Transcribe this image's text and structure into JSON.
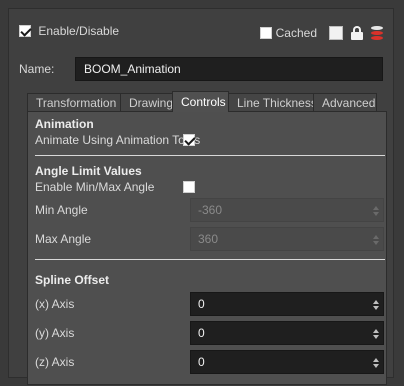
{
  "header": {
    "enable_label": "Enable/Disable",
    "enable_checked": true,
    "cached_label": "Cached",
    "cached_checked": false
  },
  "name": {
    "label": "Name:",
    "value": "BOOM_Animation"
  },
  "tabs": [
    {
      "label": "Transformation",
      "active": false
    },
    {
      "label": "Drawing",
      "active": false
    },
    {
      "label": "Controls",
      "active": true
    },
    {
      "label": "Line Thickness",
      "active": false
    },
    {
      "label": "Advanced",
      "active": false
    }
  ],
  "animation": {
    "title": "Animation",
    "animate_label": "Animate Using Animation Tools",
    "animate_checked": true
  },
  "angle_limit": {
    "title": "Angle Limit Values",
    "enable_label": "Enable Min/Max Angle",
    "enable_checked": false,
    "min_label": "Min Angle",
    "min_value": "-360",
    "max_label": "Max Angle",
    "max_value": "360"
  },
  "spline_offset": {
    "title": "Spline Offset",
    "x_label": "(x) Axis",
    "x_value": "0",
    "y_label": "(y) Axis",
    "y_value": "0",
    "z_label": "(z) Axis",
    "z_value": "0"
  },
  "colors": {
    "background": "#404040",
    "panel": "#4f4f4f",
    "field": "#1f1f1f",
    "db_icon": "#d9322a"
  }
}
